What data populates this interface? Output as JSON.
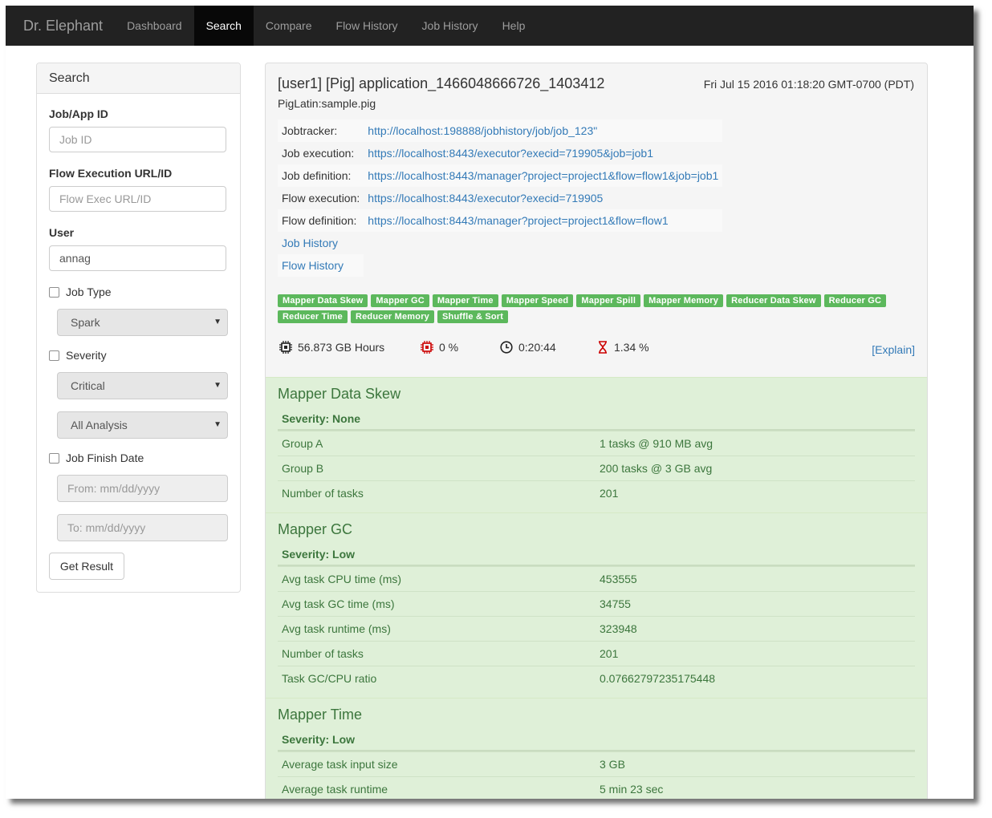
{
  "nav": {
    "brand": "Dr. Elephant",
    "items": [
      "Dashboard",
      "Search",
      "Compare",
      "Flow History",
      "Job History",
      "Help"
    ],
    "active": "Search"
  },
  "search": {
    "title": "Search",
    "job_id_label": "Job/App ID",
    "job_id_placeholder": "Job ID",
    "flow_label": "Flow Execution URL/ID",
    "flow_placeholder": "Flow Exec URL/ID",
    "user_label": "User",
    "user_value": "annag",
    "job_type_label": "Job Type",
    "job_type_value": "Spark",
    "severity_label": "Severity",
    "severity_value": "Critical",
    "analysis_value": "All Analysis",
    "finish_label": "Job Finish Date",
    "from_placeholder": "From: mm/dd/yyyy",
    "to_placeholder": "To: mm/dd/yyyy",
    "submit_label": "Get Result"
  },
  "job": {
    "title": "[user1] [Pig] application_1466048666726_1403412",
    "date": "Fri Jul 15 2016 01:18:20 GMT-0700 (PDT)",
    "subtitle": "PigLatin:sample.pig",
    "links": [
      {
        "key": "Jobtracker:",
        "value": "http://localhost:198888/jobhistory/job/job_123\""
      },
      {
        "key": "Job execution:",
        "value": "https://localhost:8443/executor?execid=719905&job=job1"
      },
      {
        "key": "Job definition:",
        "value": "https://localhost:8443/manager?project=project1&flow=flow1&job=job1"
      },
      {
        "key": "Flow execution:",
        "value": "https://localhost:8443/executor?execid=719905"
      },
      {
        "key": "Flow definition:",
        "value": "https://localhost:8443/manager?project=project1&flow=flow1"
      }
    ],
    "job_history_link": "Job History",
    "flow_history_link": "Flow History",
    "badges": [
      "Mapper Data Skew",
      "Mapper GC",
      "Mapper Time",
      "Mapper Speed",
      "Mapper Spill",
      "Mapper Memory",
      "Reducer Data Skew",
      "Reducer GC",
      "Reducer Time",
      "Reducer Memory",
      "Shuffle & Sort"
    ],
    "stats": {
      "resource": "56.873 GB Hours",
      "waste": "0 %",
      "runtime": "0:20:44",
      "wait": "1.34 %"
    },
    "explain": "[Explain]"
  },
  "sections": [
    {
      "title": "Mapper Data Skew",
      "severity": "Severity: None",
      "rows": [
        [
          "Group A",
          "1 tasks @ 910 MB avg"
        ],
        [
          "Group B",
          "200 tasks @ 3 GB avg"
        ],
        [
          "Number of tasks",
          "201"
        ]
      ]
    },
    {
      "title": "Mapper GC",
      "severity": "Severity: Low",
      "rows": [
        [
          "Avg task CPU time (ms)",
          "453555"
        ],
        [
          "Avg task GC time (ms)",
          "34755"
        ],
        [
          "Avg task runtime (ms)",
          "323948"
        ],
        [
          "Number of tasks",
          "201"
        ],
        [
          "Task GC/CPU ratio",
          "0.07662797235175448"
        ]
      ]
    },
    {
      "title": "Mapper Time",
      "severity": "Severity: Low",
      "rows": [
        [
          "Average task input size",
          "3 GB"
        ],
        [
          "Average task runtime",
          "5 min 23 sec"
        ]
      ]
    }
  ],
  "colors": {
    "navbar": "#222222",
    "badge": "#5cb85c",
    "section_bg": "#dff0d8",
    "section_text": "#3c763d",
    "link": "#337ab7",
    "icon_red": "#cc0000"
  }
}
